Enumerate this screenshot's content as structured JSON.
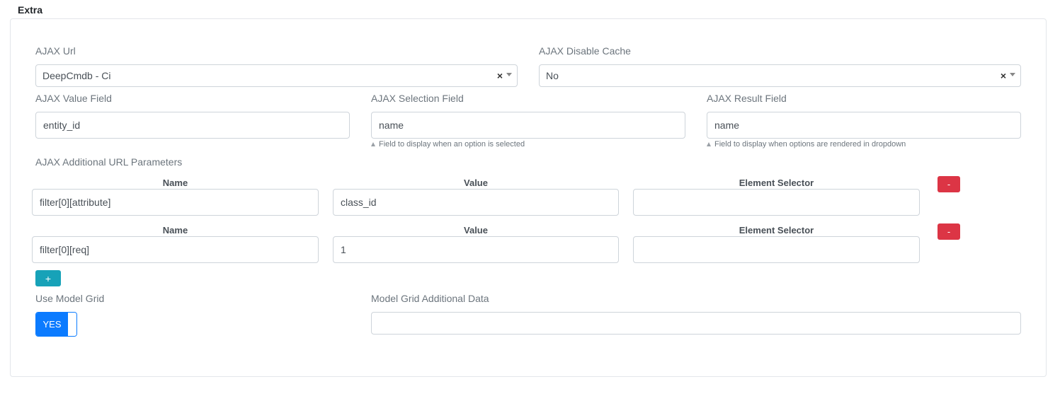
{
  "section": {
    "title": "Extra"
  },
  "ajax_url": {
    "label": "AJAX Url",
    "value": "DeepCmdb - Ci",
    "clear": "×"
  },
  "ajax_disable_cache": {
    "label": "AJAX Disable Cache",
    "value": "No",
    "clear": "×"
  },
  "ajax_value_field": {
    "label": "AJAX Value Field",
    "value": "entity_id"
  },
  "ajax_selection_field": {
    "label": "AJAX Selection Field",
    "value": "name",
    "help": "Field to display when an option is selected"
  },
  "ajax_result_field": {
    "label": "AJAX Result Field",
    "value": "name",
    "help": "Field to display when options are rendered in dropdown"
  },
  "params": {
    "label": "AJAX Additional URL Parameters",
    "headers": {
      "name": "Name",
      "value": "Value",
      "selector": "Element Selector"
    },
    "rows": [
      {
        "name": "filter[0][attribute]",
        "value": "class_id",
        "selector": "",
        "remove": "-"
      },
      {
        "name": "filter[0][req]",
        "value": "1",
        "selector": "",
        "remove": "-"
      }
    ],
    "add": "+"
  },
  "use_model_grid": {
    "label": "Use Model Grid",
    "state": "YES"
  },
  "model_grid_data": {
    "label": "Model Grid Additional Data",
    "value": ""
  },
  "colors": {
    "primary": "#0b7bff",
    "danger": "#dc3545",
    "info": "#17a2b8"
  }
}
